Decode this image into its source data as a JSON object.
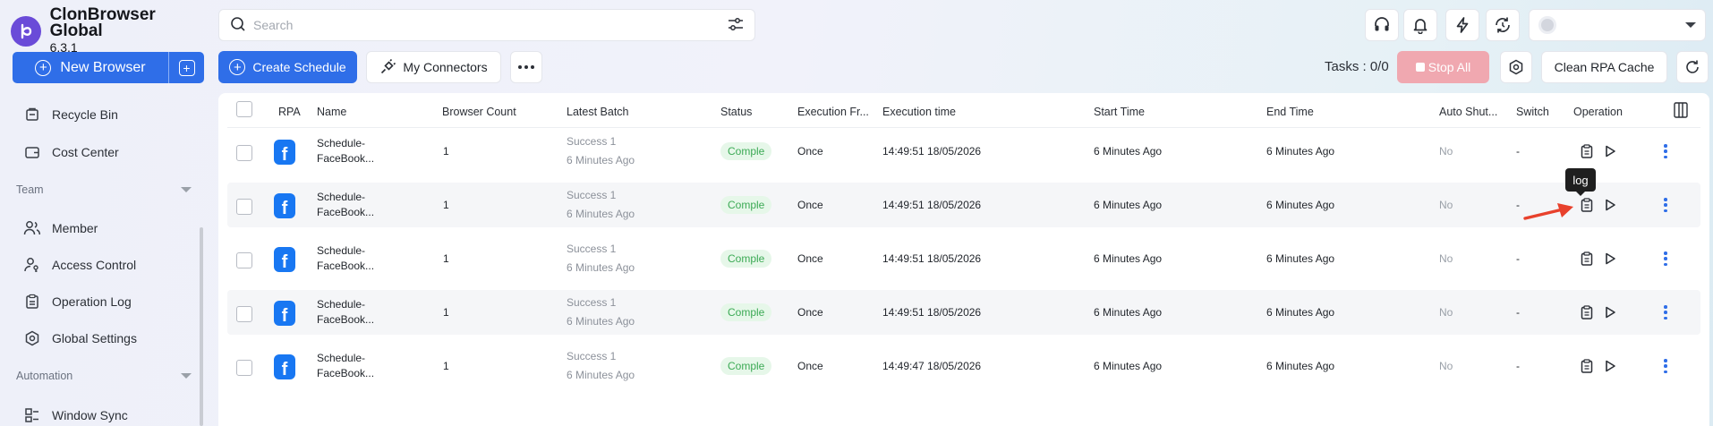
{
  "app": {
    "name": "ClonBrowser Global",
    "version": "6.3.1"
  },
  "sidebar": {
    "new_browser_label": "New Browser",
    "items": [
      {
        "label": "Recycle Bin",
        "icon": "recycle-bin-icon"
      },
      {
        "label": "Cost Center",
        "icon": "wallet-icon"
      },
      {
        "label": "Member",
        "icon": "users-icon"
      },
      {
        "label": "Access Control",
        "icon": "user-key-icon"
      },
      {
        "label": "Operation Log",
        "icon": "clipboard-icon"
      },
      {
        "label": "Global Settings",
        "icon": "hexagon-gear-icon"
      },
      {
        "label": "Window Sync",
        "icon": "window-sync-icon"
      }
    ],
    "sections": {
      "team": "Team",
      "automation": "Automation"
    }
  },
  "search": {
    "placeholder": "Search",
    "value": ""
  },
  "toolbar": {
    "create_schedule": "Create Schedule",
    "my_connectors": "My Connectors",
    "tasks": "Tasks : 0/0",
    "stop_all": "Stop All",
    "clean_cache": "Clean RPA Cache"
  },
  "table": {
    "columns": [
      "RPA",
      "Name",
      "Browser Count",
      "Latest Batch",
      "Status",
      "Execution Fr...",
      "Execution time",
      "Start Time",
      "End Time",
      "Auto Shut...",
      "Switch",
      "Operation"
    ],
    "rows": [
      {
        "name1": "Schedule-",
        "name2": "FaceBook...",
        "count": "1",
        "batch1": "Success 1",
        "batch2": "6 Minutes Ago",
        "status": "Comple",
        "freq": "Once",
        "exec_time": "14:49:51 18/05/2026",
        "start": "6 Minutes Ago",
        "end": "6 Minutes Ago",
        "auto_shut": "No",
        "switch": "-"
      },
      {
        "name1": "Schedule-",
        "name2": "FaceBook...",
        "count": "1",
        "batch1": "Success 1",
        "batch2": "6 Minutes Ago",
        "status": "Comple",
        "freq": "Once",
        "exec_time": "14:49:51 18/05/2026",
        "start": "6 Minutes Ago",
        "end": "6 Minutes Ago",
        "auto_shut": "No",
        "switch": "-"
      },
      {
        "name1": "Schedule-",
        "name2": "FaceBook...",
        "count": "1",
        "batch1": "Success 1",
        "batch2": "6 Minutes Ago",
        "status": "Comple",
        "freq": "Once",
        "exec_time": "14:49:51 18/05/2026",
        "start": "6 Minutes Ago",
        "end": "6 Minutes Ago",
        "auto_shut": "No",
        "switch": "-"
      },
      {
        "name1": "Schedule-",
        "name2": "FaceBook...",
        "count": "1",
        "batch1": "Success 1",
        "batch2": "6 Minutes Ago",
        "status": "Comple",
        "freq": "Once",
        "exec_time": "14:49:51 18/05/2026",
        "start": "6 Minutes Ago",
        "end": "6 Minutes Ago",
        "auto_shut": "No",
        "switch": "-"
      },
      {
        "name1": "Schedule-",
        "name2": "FaceBook...",
        "count": "1",
        "batch1": "Success 1",
        "batch2": "6 Minutes Ago",
        "status": "Comple",
        "freq": "Once",
        "exec_time": "14:49:47 18/05/2026",
        "start": "6 Minutes Ago",
        "end": "6 Minutes Ago",
        "auto_shut": "No",
        "switch": "-"
      }
    ]
  },
  "tooltip": {
    "text": "log"
  },
  "colors": {
    "primary": "#2f6ee8",
    "brand": "#6a4bd8",
    "success_bg": "#e6f7e9",
    "success_text": "#3caa55",
    "stop_disabled": "#f0a8b0",
    "annotation_arrow": "#e8412c"
  }
}
